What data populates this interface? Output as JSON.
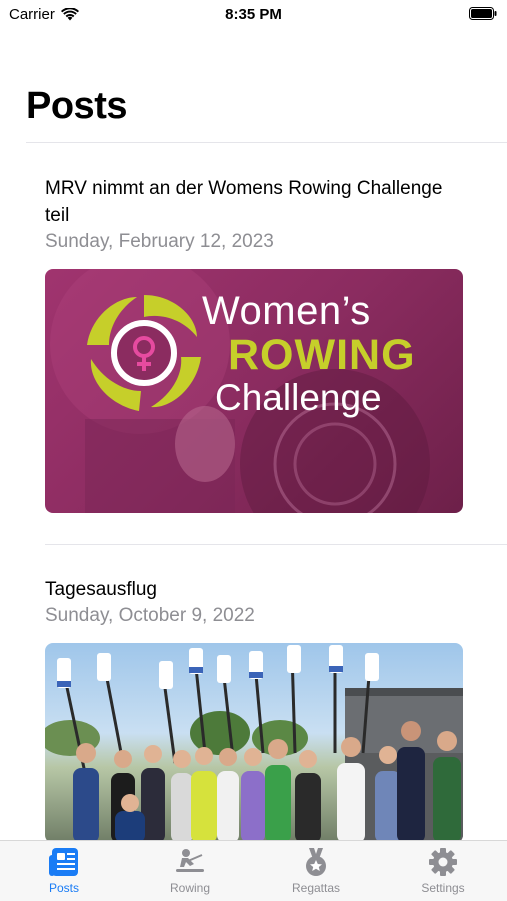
{
  "status_bar": {
    "carrier": "Carrier",
    "time": "8:35 PM"
  },
  "header": {
    "title": "Posts"
  },
  "posts": [
    {
      "title": "MRV nimmt an der Womens Rowing Challenge teil",
      "date": "Sunday, February 12, 2023",
      "image_text": {
        "line1": "Women’s",
        "line2": "ROWING",
        "line3": "Challenge"
      }
    },
    {
      "title": "Tagesausflug",
      "date": "Sunday, October 9, 2022"
    }
  ],
  "tabbar": {
    "items": [
      {
        "label": "Posts",
        "icon": "newspaper-icon",
        "active": true
      },
      {
        "label": "Rowing",
        "icon": "rowing-icon",
        "active": false
      },
      {
        "label": "Regattas",
        "icon": "medal-icon",
        "active": false
      },
      {
        "label": "Settings",
        "icon": "gear-icon",
        "active": false
      }
    ]
  },
  "colors": {
    "accent": "#1a7cf5",
    "secondary_text": "#8e8e93",
    "wrc_magenta": "#8b2c60",
    "wrc_lime": "#c6cf2a"
  }
}
